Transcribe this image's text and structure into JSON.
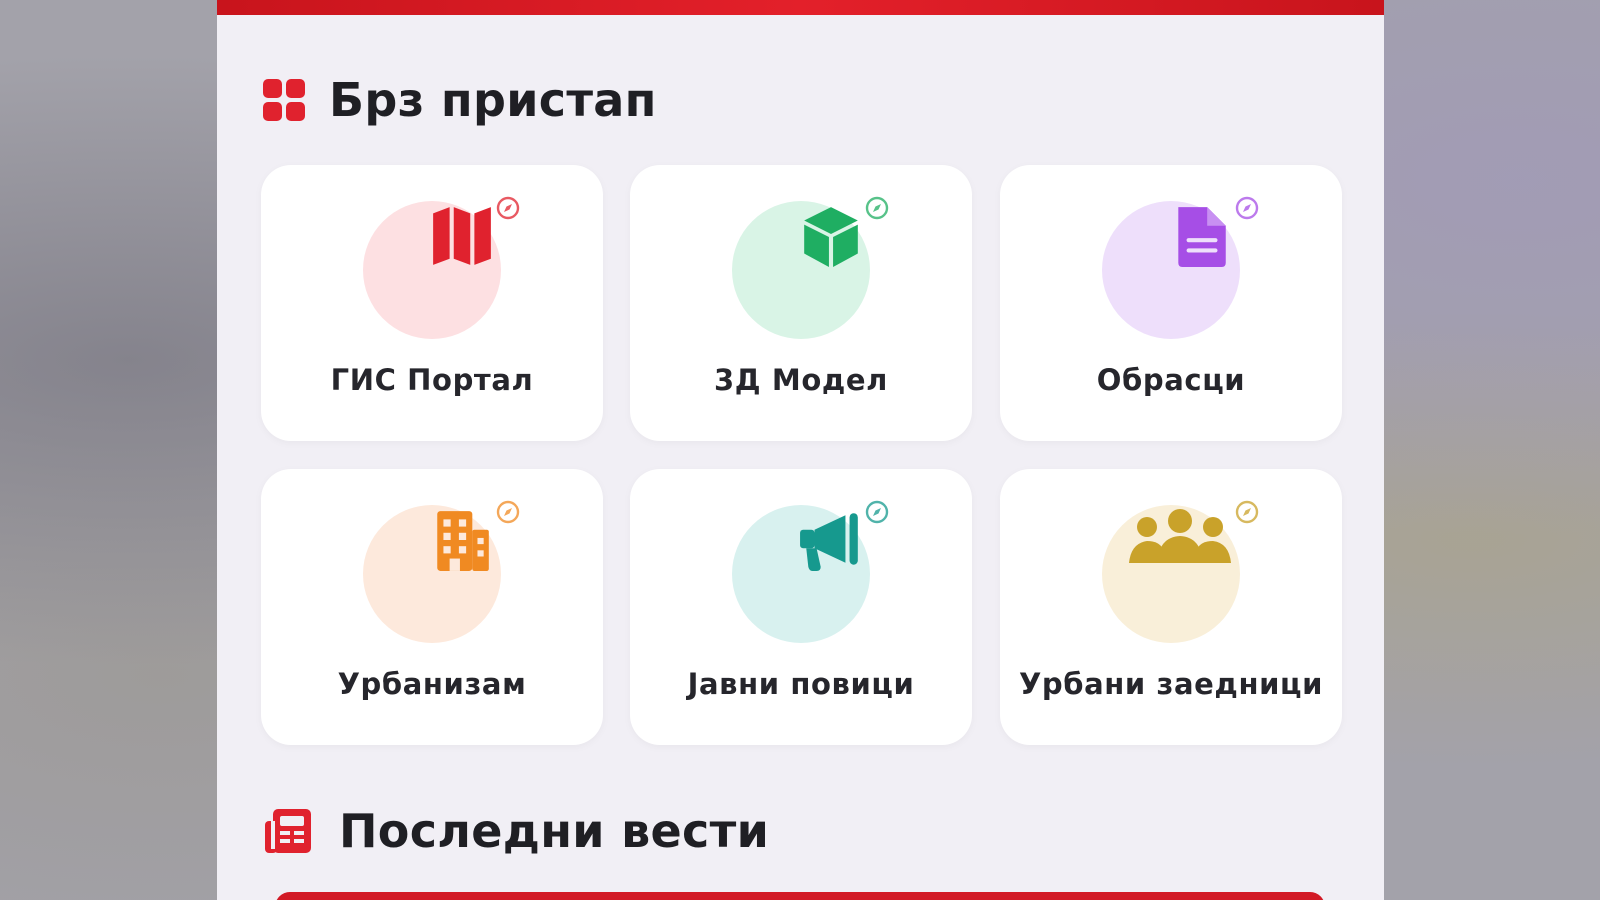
{
  "colors": {
    "accent": "#e0222e",
    "background": "#f1eff5",
    "card": "#ffffff"
  },
  "quick_access": {
    "title": "Брз пристап",
    "icon": "grid-icon",
    "items": [
      {
        "label": "ГИС Портал",
        "icon": "map-icon",
        "circle_color": "#fde0e2",
        "icon_color": "#e0222e",
        "badge": "compass-icon"
      },
      {
        "label": "3Д Модел",
        "icon": "cube-icon",
        "circle_color": "#d9f4e6",
        "icon_color": "#1fae62",
        "badge": "compass-icon"
      },
      {
        "label": "Обрасци",
        "icon": "document-icon",
        "circle_color": "#eedffb",
        "icon_color": "#a64ee6",
        "badge": "compass-icon"
      },
      {
        "label": "Урбанизам",
        "icon": "building-icon",
        "circle_color": "#fde9dc",
        "icon_color": "#f08a22",
        "badge": "compass-icon"
      },
      {
        "label": "Јавни повици",
        "icon": "megaphone-icon",
        "circle_color": "#d8f1ef",
        "icon_color": "#16998e",
        "badge": "compass-icon"
      },
      {
        "label": "Урбани заедници",
        "icon": "people-icon",
        "circle_color": "#f9efd9",
        "icon_color": "#c9a22a",
        "badge": "compass-icon"
      }
    ]
  },
  "news": {
    "title": "Последни вести",
    "icon": "newspaper-icon"
  }
}
